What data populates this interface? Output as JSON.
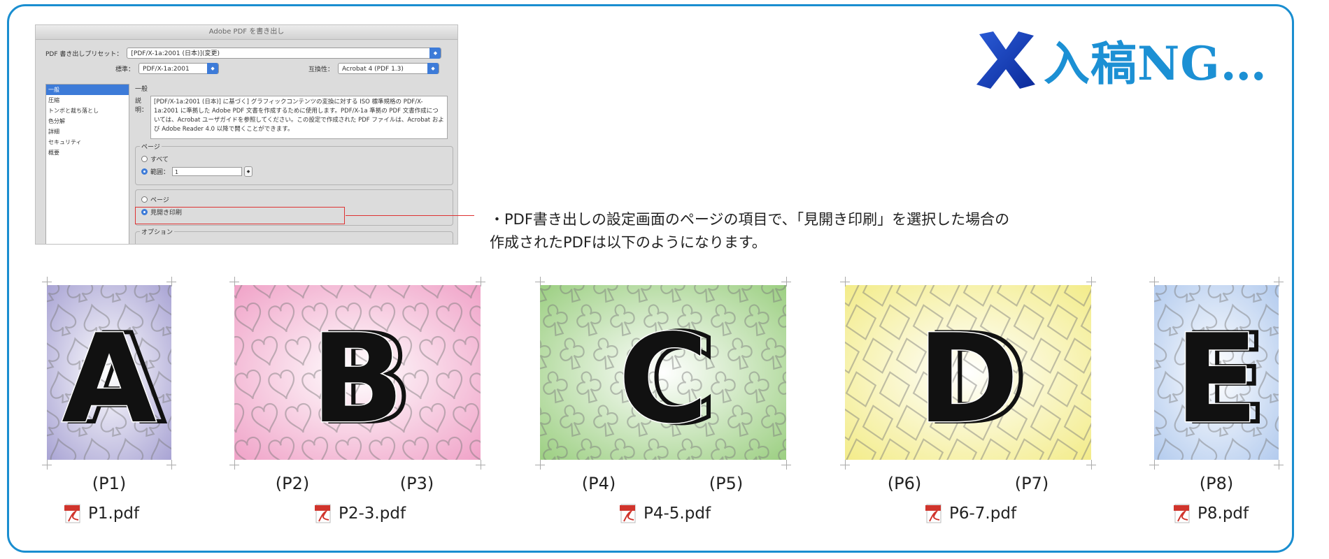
{
  "dialog": {
    "title": "Adobe PDF を書き出し",
    "preset_label": "PDF 書き出しプリセット：",
    "preset_value": "[PDF/X-1a:2001 (日本)](変更)",
    "standard_label": "標準：",
    "standard_value": "PDF/X-1a:2001",
    "compat_label": "互換性：",
    "compat_value": "Acrobat 4 (PDF 1.3)",
    "sidebar": [
      "一般",
      "圧縮",
      "トンボと裁ち落とし",
      "色分解",
      "詳細",
      "セキュリティ",
      "概要"
    ],
    "section_title": "一般",
    "desc_label": "説明：",
    "desc_text": "[PDF/X-1a:2001 (日本)] に基づく] グラフィックコンテンツの変換に対する ISO 標準規格の PDF/X-1a:2001 に準拠した Adobe PDF 文書を作成するために使用します。PDF/X-1a 準拠の PDF 文書作成については、Acrobat ユーザガイドを参照してください。この設定で作成された PDF ファイルは、Acrobat および Adobe Reader 4.0 以降で開くことができます。",
    "pages_group": "ページ",
    "all_label": "すべて",
    "range_label": "範囲：",
    "range_value": "1",
    "pages_option": "ページ",
    "spread_option": "見開き印刷",
    "options_group": "オプション"
  },
  "callout": {
    "line1": "・PDF書き出しの設定画面のページの項目で、「見開き印刷」を選択した場合の",
    "line2": "作成されたPDFは以下のようになります。"
  },
  "heading": {
    "icon": "cross-icon",
    "text": "入稿NG…",
    "color": "#1c90d4"
  },
  "pages": [
    {
      "letter": "A",
      "labels": [
        "(P1)"
      ],
      "file": "P1.pdf",
      "color": "#a9a4d4",
      "pattern": "spade"
    },
    {
      "letter": "B",
      "labels": [
        "(P2)",
        "(P3)"
      ],
      "file": "P2-3.pdf",
      "color": "#f0a3c8",
      "pattern": "heart"
    },
    {
      "letter": "C",
      "labels": [
        "(P4)",
        "(P5)"
      ],
      "file": "P4-5.pdf",
      "color": "#9ccf82",
      "pattern": "club"
    },
    {
      "letter": "D",
      "labels": [
        "(P6)",
        "(P7)"
      ],
      "file": "P6-7.pdf",
      "color": "#f3ec8a",
      "pattern": "diamond"
    },
    {
      "letter": "E",
      "labels": [
        "(P8)"
      ],
      "file": "P8.pdf",
      "color": "#b3cbee",
      "pattern": "spade"
    }
  ]
}
